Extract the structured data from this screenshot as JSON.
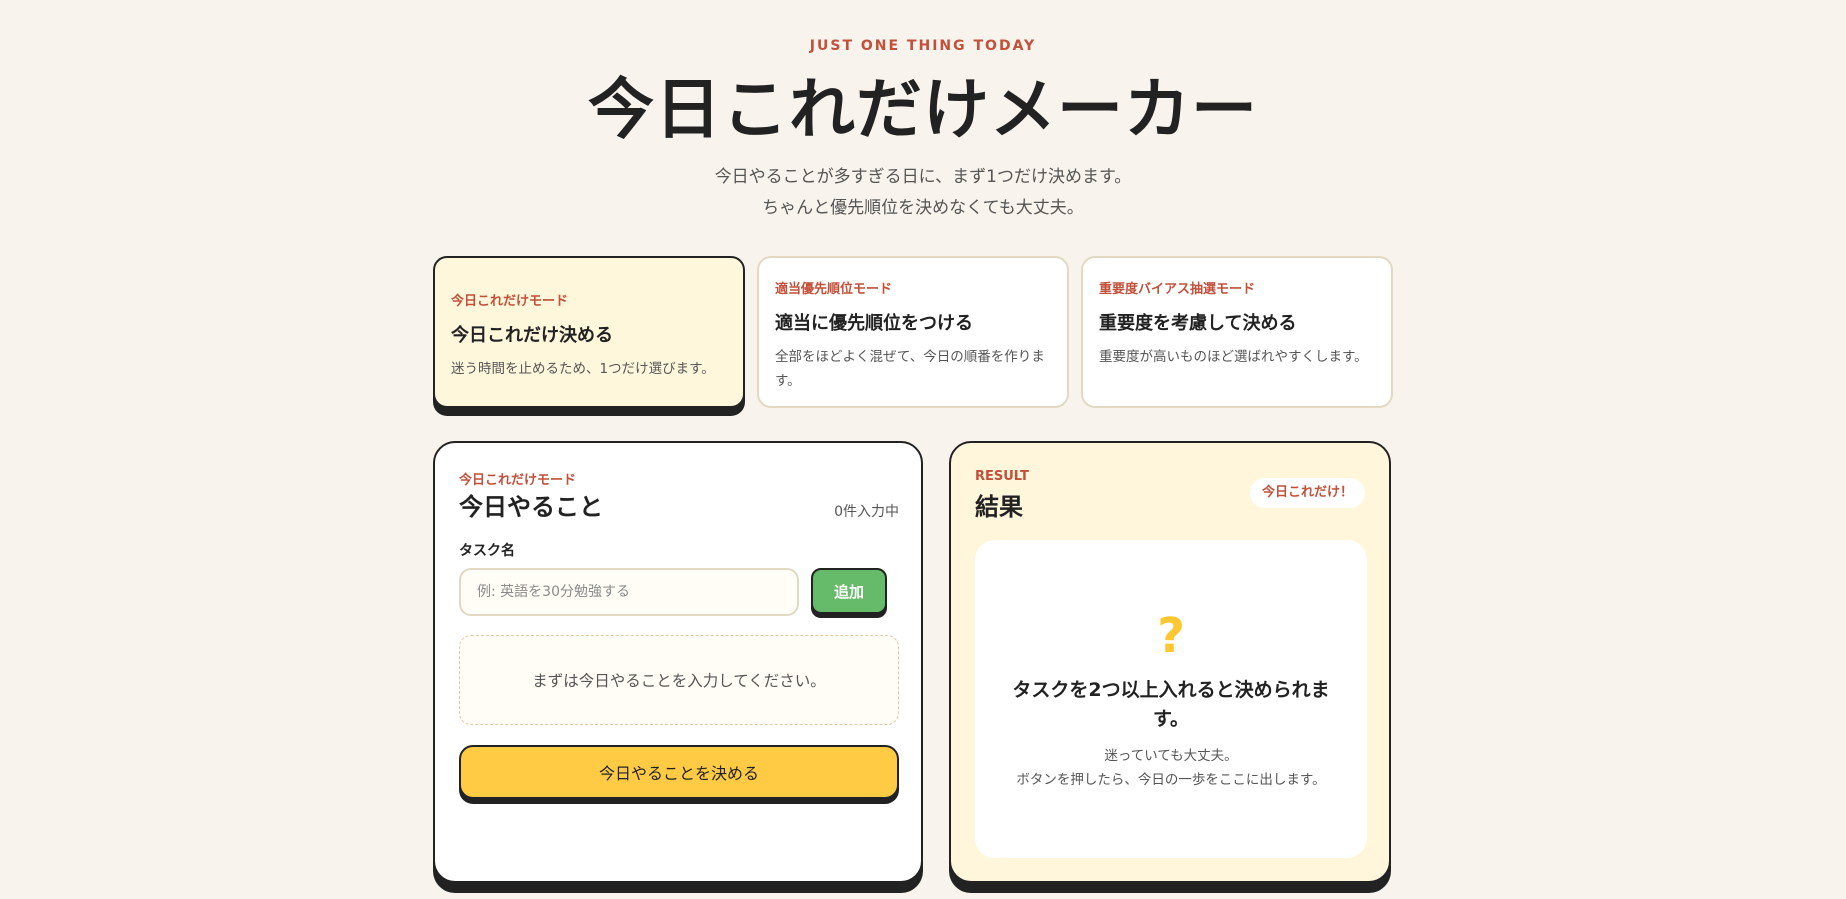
{
  "header": {
    "eyebrow": "JUST ONE THING TODAY",
    "title": "今日これだけメーカー",
    "subtitle_line1": "今日やることが多すぎる日に、まず1つだけ決めます。",
    "subtitle_line2": "ちゃんと優先順位を決めなくても大丈夫。"
  },
  "modes": [
    {
      "tag": "今日これだけモード",
      "heading": "今日これだけ決める",
      "description": "迷う時間を止めるため、1つだけ選びます。",
      "active": true
    },
    {
      "tag": "適当優先順位モード",
      "heading": "適当に優先順位をつける",
      "description": "全部をほどよく混ぜて、今日の順番を作ります。",
      "active": false
    },
    {
      "tag": "重要度バイアス抽選モード",
      "heading": "重要度を考慮して決める",
      "description": "重要度が高いものほど選ばれやすくします。",
      "active": false
    }
  ],
  "input_panel": {
    "tag": "今日これだけモード",
    "title": "今日やること",
    "count": "0件入力中",
    "field_label": "タスク名",
    "input_value": "",
    "input_placeholder": "例: 英語を30分勉強する",
    "add_label": "追加",
    "empty_message": "まずは今日やることを入力してください。",
    "decide_label": "今日やることを決める"
  },
  "result_panel": {
    "tag": "RESULT",
    "title": "結果",
    "badge": "今日これだけ！",
    "icon_glyph": "?",
    "icon_name": "question-mark-icon",
    "heading": "タスクを2つ以上入れると決められます。",
    "desc_line1": "迷っていても大丈夫。",
    "desc_line2": "ボタンを押したら、今日の一歩をここに出します。"
  },
  "colors": {
    "background": "#f8f3ec",
    "accent_red": "#c2503a",
    "active_card": "#fff7dc",
    "add_button": "#66bb6a",
    "decide_button": "#ffcb45",
    "result_bg": "#fff6dc",
    "question_mark": "#ffc832"
  }
}
